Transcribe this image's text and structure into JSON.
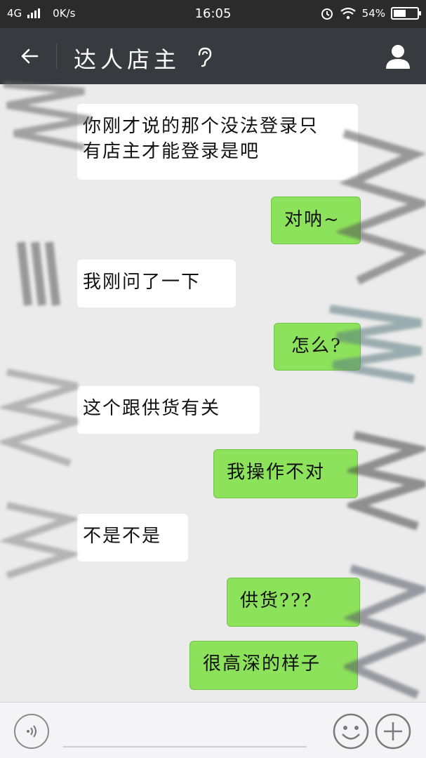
{
  "status_bar": {
    "network": "4G",
    "speed": "0K/s",
    "time": "16:05",
    "battery": "54%",
    "battery_level": 0.54
  },
  "header": {
    "title": "达人店主"
  },
  "messages": [
    {
      "side": "in",
      "text_lines": [
        "你刚才说的那个没法登录只",
        "有店主才能登录是吧"
      ]
    },
    {
      "side": "out",
      "text": "对呐~"
    },
    {
      "side": "in",
      "text": "我刚问了一下"
    },
    {
      "side": "out",
      "text": "怎么?"
    },
    {
      "side": "in",
      "text": "这个跟供货有关"
    },
    {
      "side": "out",
      "text": "我操作不对"
    },
    {
      "side": "in",
      "text": "不是不是"
    },
    {
      "side": "out",
      "text": "供货???"
    },
    {
      "side": "out",
      "text": "很高深的样子"
    }
  ],
  "colors": {
    "header_bg": "#393a3f",
    "status_bg": "#2b2b2b",
    "chat_bg": "#ebebeb",
    "bubble_out": "#8de25b",
    "bubble_in": "#ffffff"
  },
  "icons": {
    "back": "arrow-left-icon",
    "ear": "ear-icon",
    "profile": "person-icon",
    "voice": "voice-icon",
    "emoji": "smiley-icon",
    "plus": "plus-icon"
  }
}
